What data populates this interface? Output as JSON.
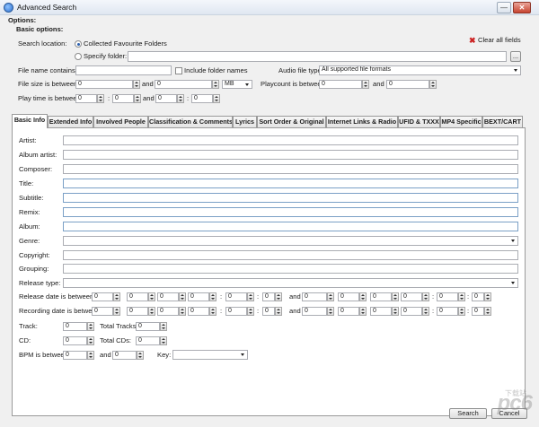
{
  "window": {
    "title": "Advanced Search",
    "minimize": "—",
    "close": "✕"
  },
  "options": {
    "label": "Options:",
    "basic_label": "Basic options:",
    "search_location_label": "Search location:",
    "collected_label": "Collected Favourite Folders",
    "specify_label": "Specify folder:",
    "specify_value": "",
    "browse_label": "...",
    "clear_all_label": "Clear all fields",
    "file_name_label": "File name contains:",
    "file_name_value": "",
    "include_folder_label": "Include folder names",
    "audio_type_label": "Audio file type:",
    "audio_type_value": "All supported file formats",
    "file_size_label": "File size is between:",
    "file_size_from": "0",
    "and_label": "and",
    "file_size_to": "0",
    "size_unit": "MB",
    "playcount_label": "Playcount is between:",
    "playcount_from": "0",
    "playcount_to": "0",
    "play_time_label": "Play time is between:",
    "play_time_from": [
      "0",
      "0"
    ],
    "play_time_to": [
      "0",
      "0"
    ],
    "colon": ":"
  },
  "tabs": [
    {
      "label": "Basic Info",
      "active": true
    },
    {
      "label": "Extended Info"
    },
    {
      "label": "Involved People"
    },
    {
      "label": "Classification & Comments"
    },
    {
      "label": "Lyrics"
    },
    {
      "label": "Sort Order & Original"
    },
    {
      "label": "Internet Links & Radio"
    },
    {
      "label": "UFID & TXXX"
    },
    {
      "label": "MP4 Specific"
    },
    {
      "label": "BEXT/CART"
    }
  ],
  "basic_info": {
    "fields": [
      {
        "label": "Artist:",
        "value": ""
      },
      {
        "label": "Album artist:",
        "value": ""
      },
      {
        "label": "Composer:",
        "value": ""
      },
      {
        "label": "Title:",
        "value": ""
      },
      {
        "label": "Subtitle:",
        "value": ""
      },
      {
        "label": "Remix:",
        "value": ""
      },
      {
        "label": "Album:",
        "value": ""
      },
      {
        "label": "Genre:",
        "value": ""
      },
      {
        "label": "Copyright:",
        "value": ""
      },
      {
        "label": "Grouping:",
        "value": ""
      },
      {
        "label": "Release type:",
        "value": ""
      }
    ],
    "release_date_label": "Release date is between:",
    "recording_date_label": "Recording date is between:",
    "zero": "0",
    "track_label": "Track:",
    "track_value": "0",
    "total_tracks_label": "Total Tracks:",
    "total_tracks_value": "0",
    "cd_label": "CD:",
    "cd_value": "0",
    "total_cds_label": "Total CDs:",
    "total_cds_value": "0",
    "bpm_label": "BPM is between:",
    "bpm_from": "0",
    "bpm_to": "0",
    "key_label": "Key:",
    "key_value": ""
  },
  "footer": {
    "search_label": "Search",
    "cancel_label": "Cancel"
  },
  "watermark": {
    "logo": "pc6",
    "site": "下载站"
  }
}
